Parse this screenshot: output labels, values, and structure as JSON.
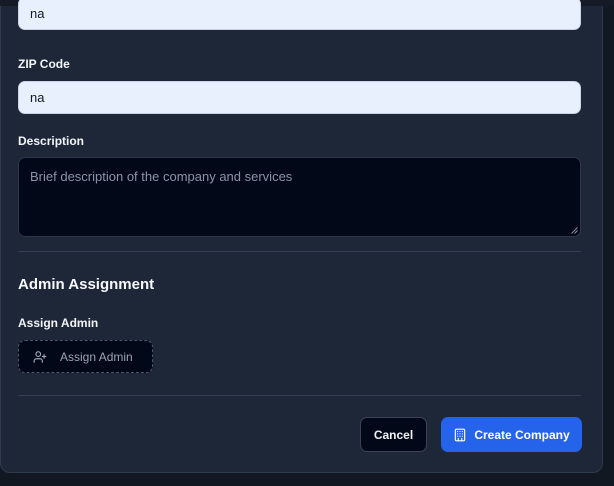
{
  "form": {
    "prev_field": {
      "value": "na"
    },
    "zip": {
      "label": "ZIP Code",
      "value": "na"
    },
    "description": {
      "label": "Description",
      "placeholder": "Brief description of the company and services"
    }
  },
  "admin": {
    "section_title": "Admin Assignment",
    "label": "Assign Admin",
    "button_label": "Assign Admin",
    "button_icon": "user-plus-icon"
  },
  "footer": {
    "cancel_label": "Cancel",
    "create_label": "Create Company",
    "create_icon": "building-icon"
  },
  "colors": {
    "modal_bg": "#1e2738",
    "primary": "#2563eb",
    "input_bg": "#e8f0fe",
    "dark_input_bg": "#020817"
  }
}
